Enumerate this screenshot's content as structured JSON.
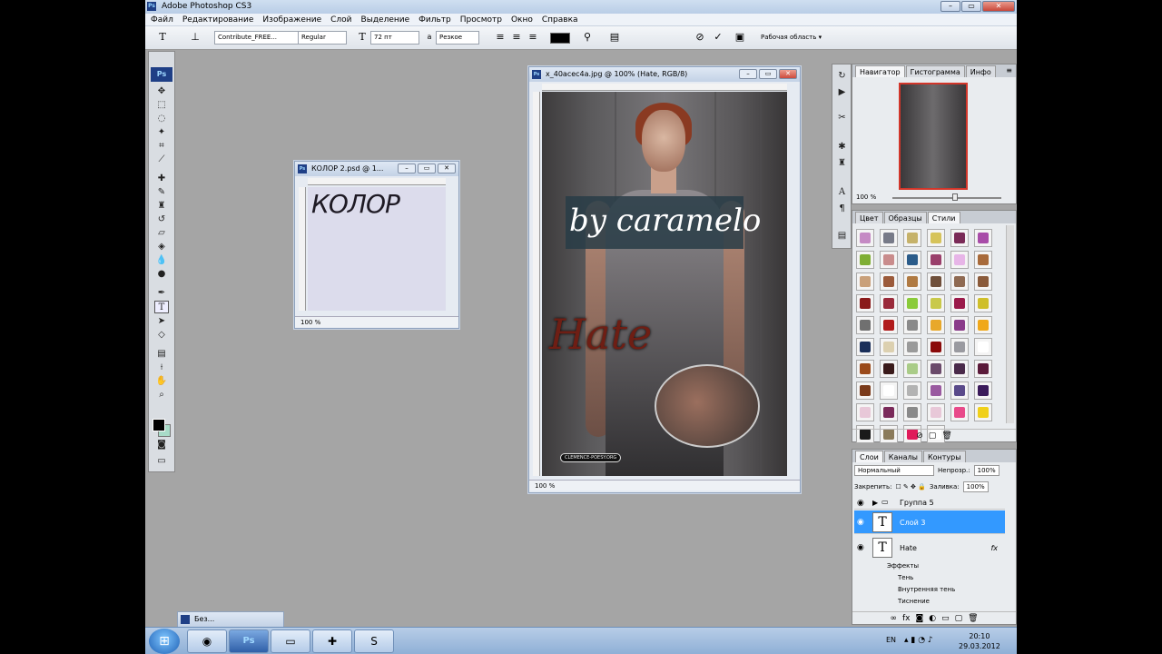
{
  "app": {
    "title": "Adobe Photoshop CS3",
    "logo": "Ps"
  },
  "menu": [
    "Файл",
    "Редактирование",
    "Изображение",
    "Слой",
    "Выделение",
    "Фильтр",
    "Просмотр",
    "Окно",
    "Справка"
  ],
  "options": {
    "tool_glyph": "T",
    "font_family": "Contribute_FREE...",
    "font_style": "Regular",
    "font_size": "72 пт",
    "aa_label": "a",
    "antialias": "Резкое",
    "workspace": "Рабочая область ▾"
  },
  "doc_kolor": {
    "title": "КОЛОР 2.psd @ 1...",
    "canvas_text": "КОЛОР",
    "zoom": "100 %"
  },
  "doc_photo": {
    "title": "x_40acec4a.jpg @ 100% (Hate, RGB/8)",
    "band_text": "by caramelo",
    "hate_text": "Hate",
    "signature": "CLEMENCE-POESY.ORG",
    "zoom": "100 %"
  },
  "navigator": {
    "tabs": [
      "Навигатор",
      "Гистограмма",
      "Инфо"
    ],
    "zoom": "100 %"
  },
  "styles": {
    "tabs": [
      "Цвет",
      "Образцы",
      "Стили"
    ],
    "swatches": [
      "#c58ac4",
      "#777a88",
      "#c6b26a",
      "#d6c35a",
      "#7a2a57",
      "#a84ca8",
      "#7fae34",
      "#c98c8c",
      "#2b5c8a",
      "#9a3f6b",
      "#e7b5e7",
      "#a86a3a",
      "#c9a07a",
      "#9b5a3a",
      "#b07a42",
      "#6f4f3a",
      "#8f6a52",
      "#8a5a3a",
      "#8a1a1a",
      "#9a2a3a",
      "#8acb3a",
      "#c9c94a",
      "#9a1a4a",
      "#cfbf2a",
      "#707070",
      "#b01a1a",
      "#8a8a8a",
      "#e8a82a",
      "#8a3a8a",
      "#f0a81a",
      "#1a2f5a",
      "#dcd0b0",
      "#9a9a9a",
      "#8a0a0a",
      "#9a9aa0",
      "#ffffff",
      "#9a4a1a",
      "#3a1a1a",
      "#aacc88",
      "#6a4a6a",
      "#4a2a4a",
      "#5a1a3a",
      "#7a3a1a",
      "#ffffff",
      "#b3b3b3",
      "#9a5aa0",
      "#5a4a8a",
      "#3a1a5a",
      "#e8c8d8",
      "#7a2a5a",
      "#8a8a8a",
      "#e8c8d8",
      "#e84a8a",
      "#f0d01a",
      "#1a1a1a",
      "#8a7a5a",
      "#e01a5a",
      "#ffffff"
    ]
  },
  "layers": {
    "tabs": [
      "Слои",
      "Каналы",
      "Контуры"
    ],
    "blend_mode": "Нормальный",
    "opacity_label": "Непрозр.:",
    "opacity": "100%",
    "lock_label": "Закрепить:",
    "fill_label": "Заливка:",
    "fill": "100%",
    "items": [
      {
        "name": "Группа 5"
      },
      {
        "name": "Слой 3"
      },
      {
        "name": "Hate",
        "fx": "fx"
      }
    ],
    "effects_label": "Эффекты",
    "effects": [
      "Тень",
      "Внутренняя тень",
      "Тиснение"
    ]
  },
  "minimized": {
    "title": "Без..."
  },
  "taskbar": {
    "lang": "EN",
    "time": "20:10",
    "date": "29.03.2012"
  }
}
